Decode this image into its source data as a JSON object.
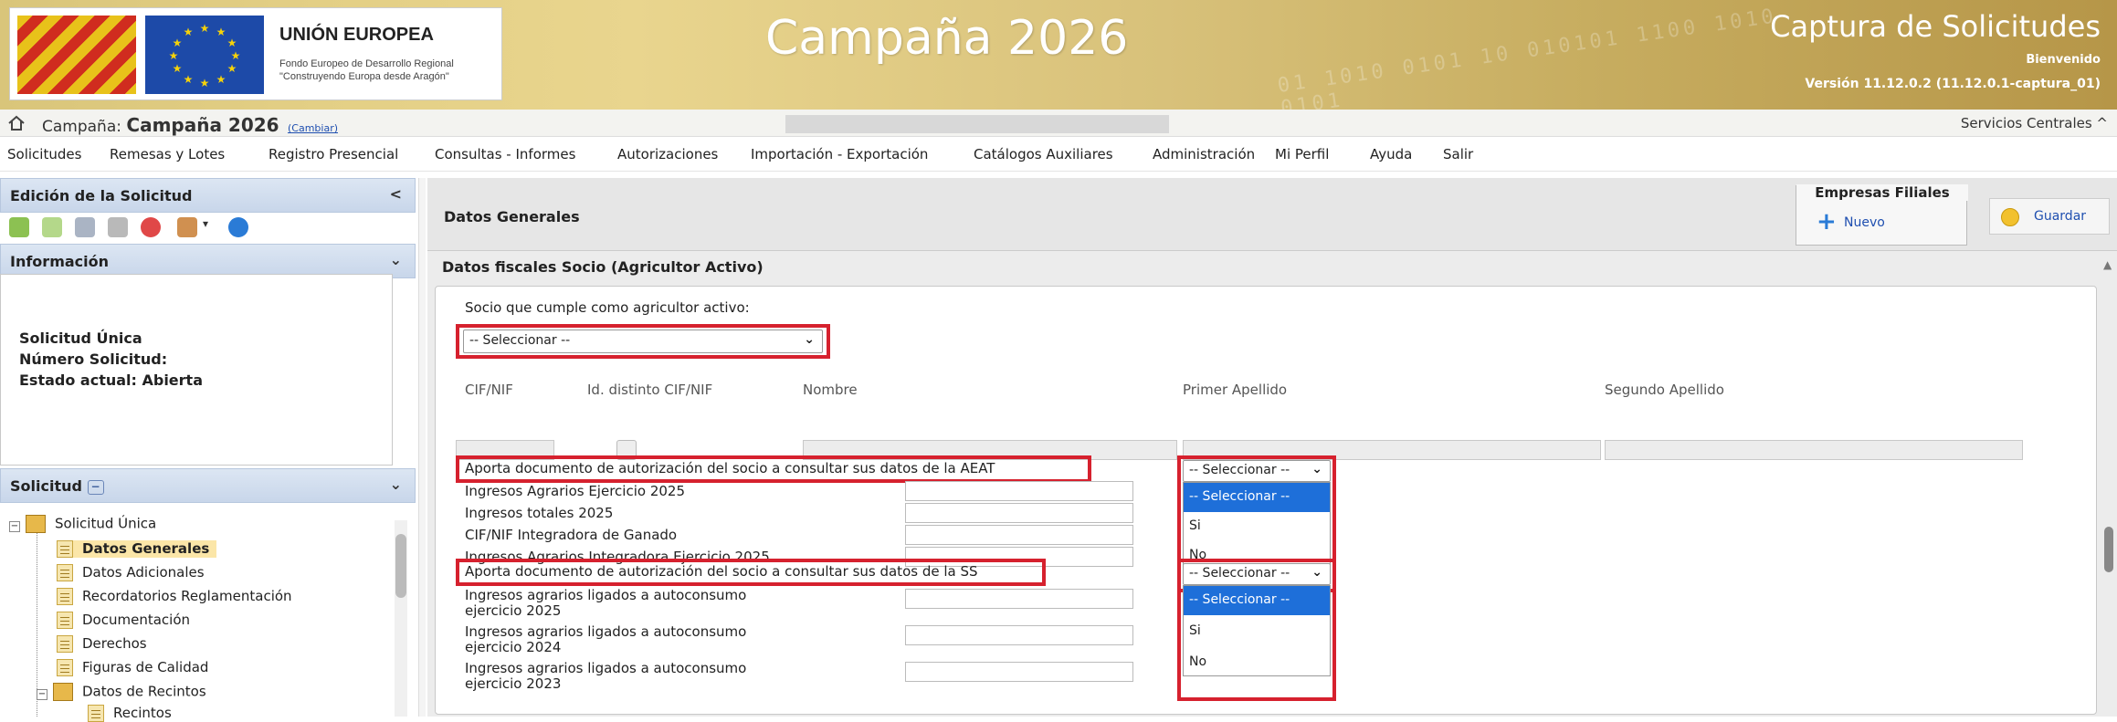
{
  "header": {
    "eu_title": "UNIÓN EUROPEA",
    "eu_sub1": "Fondo Europeo de Desarrollo Regional",
    "eu_sub2": "\"Construyendo Europa desde Aragón\"",
    "campaign_title": "Campaña 2026",
    "app_title": "Captura de Solicitudes",
    "bienvenido": "Bienvenido",
    "version": "Versión 11.12.0.2 (11.12.0.1-captura_01)"
  },
  "campaign_bar": {
    "label": "Campaña:",
    "name": "Campaña 2026",
    "change_link": "(Cambiar)",
    "servicios": "Servicios Centrales ^"
  },
  "menu": [
    "Solicitudes",
    "Remesas y Lotes",
    "Registro Presencial",
    "Consultas - Informes",
    "Autorizaciones",
    "Importación - Exportación",
    "Catálogos Auxiliares",
    "Administración",
    "Mi Perfil",
    "Ayuda",
    "Salir"
  ],
  "sidebar": {
    "edicion_title": "Edición de la Solicitud",
    "informacion_title": "Información",
    "info_lines": [
      "Solicitud Única",
      "Número Solicitud: ",
      "Estado actual: Abierta"
    ],
    "solicitud_title": "Solicitud",
    "tree": {
      "root": "Solicitud Única",
      "items": [
        "Datos Generales",
        "Datos Adicionales",
        "Recordatorios Reglamentación",
        "Documentación",
        "Derechos",
        "Figuras de Calidad",
        "Datos de Recintos"
      ],
      "sub_items": [
        "Recintos"
      ]
    }
  },
  "main": {
    "datos_generales": "Datos Generales",
    "empresas_filiales": "Empresas Filiales",
    "nuevo": "Nuevo",
    "guardar": "Guardar",
    "section_title": "Datos fiscales Socio (Agricultor Activo)",
    "socio_label": "Socio que cumple como agricultor activo:",
    "socio_select": "-- Seleccionar --",
    "col_cif": "CIF/NIF",
    "col_id_distinto": "Id. distinto CIF/NIF",
    "col_nombre": "Nombre",
    "col_primer": "Primer Apellido",
    "col_segundo": "Segundo Apellido",
    "aeat_label": "Aporta documento de autorización del socio a consultar sus datos de la AEAT",
    "aeat_select": "-- Seleccionar --",
    "aeat_options": [
      "-- Seleccionar --",
      "Si",
      "No"
    ],
    "ingresos_agr_2025": "Ingresos Agrarios Ejercicio 2025",
    "ingresos_tot_2025": "Ingresos totales 2025",
    "cif_integradora": "CIF/NIF Integradora de Ganado",
    "ingresos_integradora": "Ingresos Agrarios Integradora Ejercicio 2025",
    "ss_label": "Aporta documento de autorización del socio a consultar sus datos de la SS",
    "ss_select": "-- Seleccionar --",
    "ss_options": [
      "-- Seleccionar --",
      "Si",
      "No"
    ],
    "auto_2025_a": "Ingresos agrarios ligados a autoconsumo",
    "auto_2025_b": "ejercicio 2025",
    "auto_2024_a": "Ingresos agrarios ligados a autoconsumo",
    "auto_2024_b": "ejercicio 2024",
    "auto_2023_a": "Ingresos agrarios ligados a autoconsumo",
    "auto_2023_b": "ejercicio 2023"
  },
  "colors": {
    "highlight_red": "#d6212e",
    "selected_option": "#1e6fd9",
    "link_blue": "#1f4fb0"
  }
}
